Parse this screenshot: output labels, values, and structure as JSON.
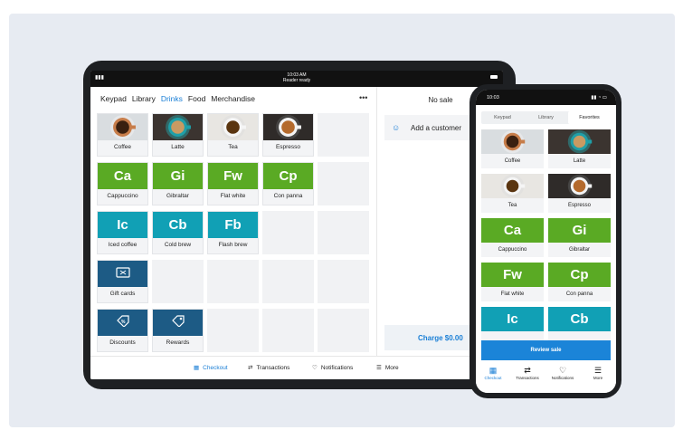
{
  "tablet": {
    "status": {
      "time": "10:03 AM",
      "subtitle": "Reader ready"
    },
    "tabs": [
      "Keypad",
      "Library",
      "Drinks",
      "Food",
      "Merchandise"
    ],
    "active_tab": "Drinks",
    "more": "•••",
    "tiles": [
      {
        "label": "Coffee",
        "kind": "photo",
        "photo": "coffee"
      },
      {
        "label": "Latte",
        "kind": "photo",
        "photo": "latte"
      },
      {
        "label": "Tea",
        "kind": "photo",
        "photo": "tea"
      },
      {
        "label": "Espresso",
        "kind": "photo",
        "photo": "espresso"
      },
      {
        "label": "",
        "kind": "empty"
      },
      {
        "label": "Cappuccino",
        "kind": "block",
        "abbr": "Ca",
        "color": "#5aaa24"
      },
      {
        "label": "Gibraltar",
        "kind": "block",
        "abbr": "Gi",
        "color": "#5aaa24"
      },
      {
        "label": "Flat white",
        "kind": "block",
        "abbr": "Fw",
        "color": "#5aaa24"
      },
      {
        "label": "Con panna",
        "kind": "block",
        "abbr": "Cp",
        "color": "#5aaa24"
      },
      {
        "label": "",
        "kind": "empty"
      },
      {
        "label": "Iced coffee",
        "kind": "block",
        "abbr": "Ic",
        "color": "#11a0b5"
      },
      {
        "label": "Cold brew",
        "kind": "block",
        "abbr": "Cb",
        "color": "#11a0b5"
      },
      {
        "label": "Flash brew",
        "kind": "block",
        "abbr": "Fb",
        "color": "#11a0b5"
      },
      {
        "label": "",
        "kind": "empty"
      },
      {
        "label": "",
        "kind": "empty"
      },
      {
        "label": "Gift cards",
        "kind": "icon",
        "icon": "gift-card-icon",
        "color": "#1d5b85"
      },
      {
        "label": "",
        "kind": "empty"
      },
      {
        "label": "",
        "kind": "empty"
      },
      {
        "label": "",
        "kind": "empty"
      },
      {
        "label": "",
        "kind": "empty"
      },
      {
        "label": "Discounts",
        "kind": "icon",
        "icon": "discount-tag-icon",
        "color": "#1d5b85"
      },
      {
        "label": "Rewards",
        "kind": "icon",
        "icon": "rewards-tag-icon",
        "color": "#1d5b85"
      },
      {
        "label": "",
        "kind": "empty"
      },
      {
        "label": "",
        "kind": "empty"
      },
      {
        "label": "",
        "kind": "empty"
      }
    ],
    "cart": {
      "title": "No sale",
      "add_customer": "Add a customer",
      "charge": "Charge $0.00"
    },
    "bottom_nav": [
      {
        "label": "Checkout",
        "icon": "grid-icon",
        "active": true
      },
      {
        "label": "Transactions",
        "icon": "arrows-icon",
        "active": false
      },
      {
        "label": "Notifications",
        "icon": "bell-icon",
        "active": false
      },
      {
        "label": "More",
        "icon": "menu-icon",
        "active": false
      }
    ]
  },
  "phone": {
    "status": {
      "time": "10:03"
    },
    "tabs": [
      "Keypad",
      "Library",
      "Favorites"
    ],
    "active_tab": "Favorites",
    "tiles": [
      {
        "label": "Coffee",
        "kind": "photo",
        "photo": "coffee"
      },
      {
        "label": "Latte",
        "kind": "photo",
        "photo": "latte"
      },
      {
        "label": "Tea",
        "kind": "photo",
        "photo": "tea"
      },
      {
        "label": "Espresso",
        "kind": "photo",
        "photo": "espresso"
      },
      {
        "label": "Cappuccino",
        "kind": "block",
        "abbr": "Ca",
        "color": "#5aaa24"
      },
      {
        "label": "Gibraltar",
        "kind": "block",
        "abbr": "Gi",
        "color": "#5aaa24"
      },
      {
        "label": "Flat white",
        "kind": "block",
        "abbr": "Fw",
        "color": "#5aaa24"
      },
      {
        "label": "Con panna",
        "kind": "block",
        "abbr": "Cp",
        "color": "#5aaa24"
      },
      {
        "label": "",
        "kind": "block",
        "abbr": "Ic",
        "color": "#11a0b5"
      },
      {
        "label": "",
        "kind": "block",
        "abbr": "Cb",
        "color": "#11a0b5"
      }
    ],
    "review_sale": "Review sale",
    "bottom_nav": [
      {
        "label": "Checkout",
        "icon": "grid-icon",
        "active": true
      },
      {
        "label": "Transactions",
        "icon": "arrows-icon",
        "active": false
      },
      {
        "label": "Notifications",
        "icon": "bell-icon",
        "active": false
      },
      {
        "label": "More",
        "icon": "menu-icon",
        "active": false
      }
    ]
  }
}
